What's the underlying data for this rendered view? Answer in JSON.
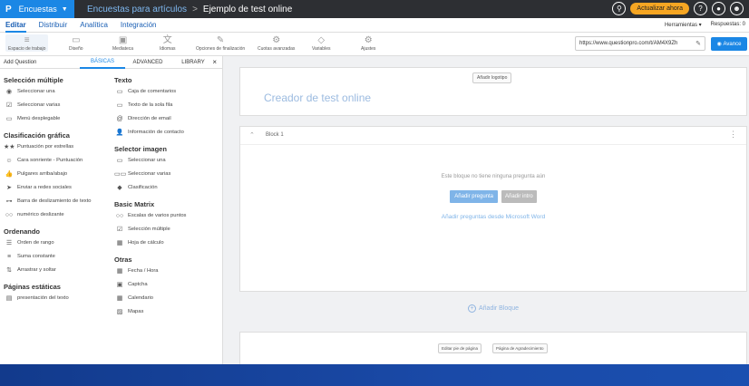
{
  "topbar": {
    "logo": "P",
    "app_name": "Encuestas",
    "breadcrumb_1": "Encuestas para artículos",
    "breadcrumb_sep": ">",
    "breadcrumb_2": "Ejemplo de test online",
    "upgrade_label": "Actualizar ahora",
    "help_icon": "?",
    "accent": "#1b87e5",
    "upgrade_color": "#f6a623"
  },
  "menubar": {
    "items": [
      {
        "label": "Editar"
      },
      {
        "label": "Distribuir"
      },
      {
        "label": "Analítica"
      },
      {
        "label": "Integración"
      }
    ],
    "tools_label": "Herramientas ▾",
    "responses_label": "Respuestas: 0"
  },
  "toolbar": {
    "tools": [
      {
        "label": "Espacio de trabajo",
        "icon": "≡"
      },
      {
        "label": "Diseño",
        "icon": "▭"
      },
      {
        "label": "Mediateca",
        "icon": "▣"
      },
      {
        "label": "Idiomas",
        "icon": "文"
      },
      {
        "label": "Opciones de finalización",
        "icon": "✎"
      },
      {
        "label": "Cuotas avanzadas",
        "icon": "⚙"
      },
      {
        "label": "Variables",
        "icon": "◇"
      },
      {
        "label": "Ajustes",
        "icon": "⚙"
      }
    ],
    "url": "https://www.questionpro.com/t/AM4X9Zh",
    "avance_label": "Avance"
  },
  "panel": {
    "add_question": "Add Question",
    "tabs": [
      "BÁSICAS",
      "ADVANCED",
      "LIBRARY"
    ],
    "close": "×",
    "col1": [
      {
        "section": "Selección múltiple",
        "items": [
          {
            "icon": "◉",
            "label": "Seleccionar una"
          },
          {
            "icon": "☑",
            "label": "Seleccionar varias"
          },
          {
            "icon": "▭",
            "label": "Menú desplegable"
          }
        ]
      },
      {
        "section": "Clasificación gráfica",
        "items": [
          {
            "icon": "★★",
            "label": "Puntuación por estrellas"
          },
          {
            "icon": "☺",
            "label": "Cara sonriente - Puntuación"
          },
          {
            "icon": "👍",
            "label": "Pulgares arriba/abajo"
          },
          {
            "icon": "➤",
            "label": "Enviar a redes sociales"
          },
          {
            "icon": "⊶",
            "label": "Barra de deslizamiento de texto"
          },
          {
            "icon": "○○",
            "label": "numérico deslizante"
          }
        ]
      },
      {
        "section": "Ordenando",
        "items": [
          {
            "icon": "☰",
            "label": "Orden de rango"
          },
          {
            "icon": "≡",
            "label": "Suma constante"
          },
          {
            "icon": "⇅",
            "label": "Arrastrar y soltar"
          }
        ]
      },
      {
        "section": "Páginas estáticas",
        "items": [
          {
            "icon": "▤",
            "label": "presentación del texto"
          }
        ]
      }
    ],
    "col2": [
      {
        "section": "Texto",
        "items": [
          {
            "icon": "▭",
            "label": "Caja de comentarios"
          },
          {
            "icon": "▭",
            "label": "Texto de la sola fila"
          },
          {
            "icon": "@",
            "label": "Dirección de email"
          },
          {
            "icon": "👤",
            "label": "Información de contacto"
          }
        ]
      },
      {
        "section": "Selector imagen",
        "items": [
          {
            "icon": "▭",
            "label": "Seleccionar una"
          },
          {
            "icon": "▭▭",
            "label": "Seleccionar varias"
          },
          {
            "icon": "◆",
            "label": "Clasificación"
          }
        ]
      },
      {
        "section": "Basic Matrix",
        "items": [
          {
            "icon": "○○",
            "label": "Escalas de varios puntos"
          },
          {
            "icon": "☑",
            "label": "Selección múltiple"
          },
          {
            "icon": "▦",
            "label": "Hoja de cálculo"
          }
        ]
      },
      {
        "section": "Otras",
        "items": [
          {
            "icon": "▦",
            "label": "Fecha / Hora"
          },
          {
            "icon": "▣",
            "label": "Captcha"
          },
          {
            "icon": "▦",
            "label": "Calendario"
          },
          {
            "icon": "▨",
            "label": "Mapas"
          }
        ]
      }
    ]
  },
  "canvas": {
    "logo_button": "Añadir logotipo",
    "survey_title": "Creador de test online",
    "block_name": "Block 1",
    "empty_text": "Este bloque no tiene ninguna pregunta aún",
    "add_question": "Añadir pregunta",
    "add_intro": "Añadir intro",
    "word_link": "Añadir preguntas desde Microsoft Word",
    "add_block": "Añadir Bloque",
    "footer_edit": "Editar pie de página",
    "footer_thanks": "Página de Agradecimiento"
  }
}
